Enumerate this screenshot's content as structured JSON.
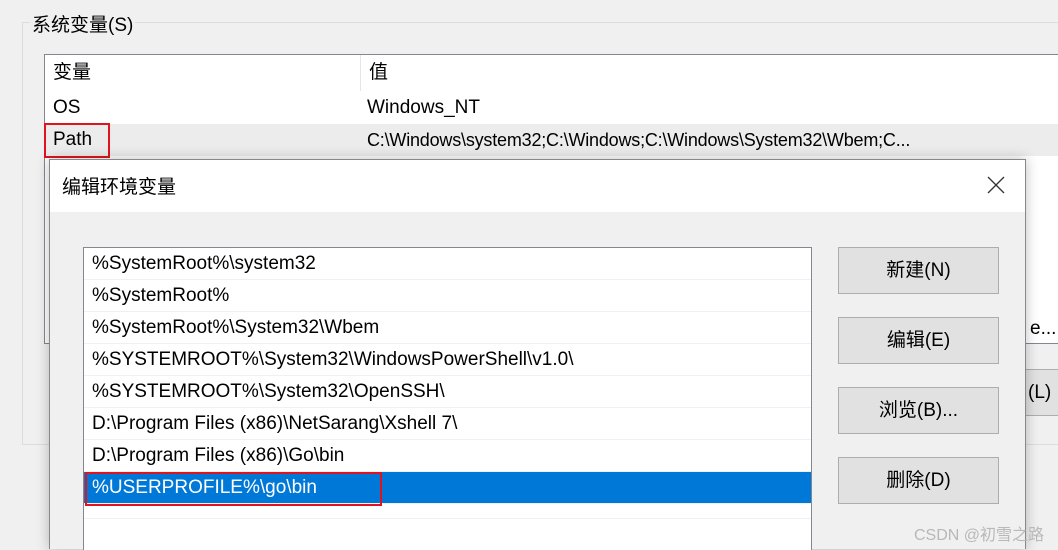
{
  "system_vars": {
    "group_title": "系统变量(S)",
    "col_name": "变量",
    "col_value": "值",
    "rows": [
      {
        "name": "OS",
        "value": "Windows_NT"
      },
      {
        "name": "Path",
        "value": "C:\\Windows\\system32;C:\\Windows;C:\\Windows\\System32\\Wbem;C..."
      }
    ],
    "partial_button_text": "e...",
    "partial_button2_text": "(L)"
  },
  "dialog": {
    "title": "编辑环境变量",
    "items": [
      "%SystemRoot%\\system32",
      "%SystemRoot%",
      "%SystemRoot%\\System32\\Wbem",
      "%SYSTEMROOT%\\System32\\WindowsPowerShell\\v1.0\\",
      "%SYSTEMROOT%\\System32\\OpenSSH\\",
      "D:\\Program Files (x86)\\NetSarang\\Xshell 7\\",
      "D:\\Program Files (x86)\\Go\\bin",
      "%USERPROFILE%\\go\\bin"
    ],
    "selected_index": 7,
    "buttons": {
      "new": "新建(N)",
      "edit": "编辑(E)",
      "browse": "浏览(B)...",
      "delete": "删除(D)"
    }
  },
  "watermark": "CSDN @初雪之路",
  "colors": {
    "selection": "#0078d7",
    "highlight_box": "#e0141e"
  }
}
